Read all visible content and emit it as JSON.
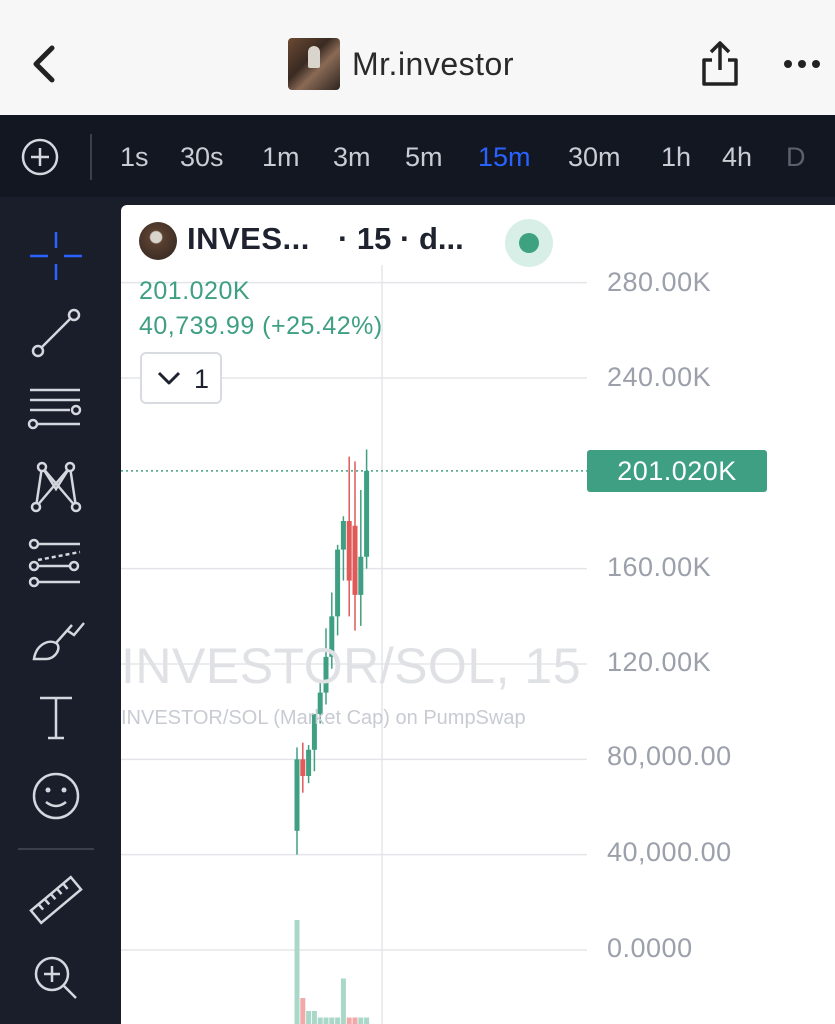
{
  "header": {
    "title": "Mr.investor",
    "back_icon": "chevron-left-icon",
    "share_icon": "share-icon",
    "more_icon": "more-dots-icon"
  },
  "timeframes": {
    "items": [
      "1s",
      "30s",
      "1m",
      "3m",
      "5m",
      "15m",
      "30m",
      "1h",
      "4h",
      "D"
    ],
    "selected": "15m",
    "active_color": "#2962ff"
  },
  "toolbar": {
    "tools": [
      "crosshair-icon",
      "trend-line-icon",
      "fib-retracement-icon",
      "pattern-icon",
      "forecast-icon",
      "brush-icon",
      "text-icon",
      "emoji-icon",
      "ruler-icon",
      "zoom-in-icon"
    ]
  },
  "symbol": {
    "name": "INVES...",
    "meta": "· 15 · d...",
    "price": "201.020K",
    "change": "40,739.99 (+25.42%)",
    "indicator_count": "1"
  },
  "watermark": {
    "title": "INVESTOR/SOL, 15",
    "subtitle": "INVESTOR/SOL (Market Cap) on PumpSwap"
  },
  "colors": {
    "up": "#3e9f82",
    "down": "#e05a5a",
    "chart_bg": "#ffffff",
    "panel_bg": "#131722"
  },
  "chart_data": {
    "type": "candlestick",
    "y_tick_labels": [
      "280.00K",
      "240.00K",
      "160.00K",
      "120.00K",
      "80,000.00",
      "40,000.00",
      "0.0000"
    ],
    "y_ticks": [
      280000,
      240000,
      160000,
      120000,
      80000,
      40000,
      0
    ],
    "ylim": [
      -10000,
      290000
    ],
    "last_price_label": "201.020K",
    "last_price": 201020,
    "candles": [
      {
        "open": 50000,
        "high": 85000,
        "low": 40000,
        "close": 80000
      },
      {
        "open": 80000,
        "high": 87000,
        "low": 66000,
        "close": 73000
      },
      {
        "open": 73000,
        "high": 86000,
        "low": 70000,
        "close": 84000
      },
      {
        "open": 84000,
        "high": 99000,
        "low": 75000,
        "close": 99000
      },
      {
        "open": 99000,
        "high": 112000,
        "low": 95000,
        "close": 108000
      },
      {
        "open": 108000,
        "high": 135000,
        "low": 103000,
        "close": 123000
      },
      {
        "open": 123000,
        "high": 150000,
        "low": 118000,
        "close": 140000
      },
      {
        "open": 140000,
        "high": 170000,
        "low": 132000,
        "close": 168000
      },
      {
        "open": 168000,
        "high": 182000,
        "low": 155000,
        "close": 180000
      },
      {
        "open": 180000,
        "high": 207000,
        "low": 140000,
        "close": 155000
      },
      {
        "open": 178000,
        "high": 205000,
        "low": 134000,
        "close": 149000
      },
      {
        "open": 149000,
        "high": 193000,
        "low": 136000,
        "close": 165000
      },
      {
        "open": 165000,
        "high": 210000,
        "low": 160000,
        "close": 201020
      }
    ],
    "volume": [
      0.8,
      0.2,
      0.1,
      0.1,
      0.05,
      0.05,
      0.05,
      0.05,
      0.35,
      0.05,
      0.05,
      0.05,
      0.05
    ]
  }
}
